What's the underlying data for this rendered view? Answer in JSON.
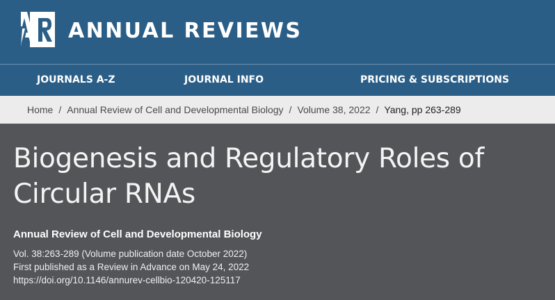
{
  "header": {
    "logo_text": "ANNUAL REVIEWS",
    "colors": {
      "header_bg": "#2a5e87",
      "content_bg": "#545559",
      "breadcrumb_bg": "#ececec"
    }
  },
  "nav": {
    "items": [
      {
        "label": "JOURNALS A-Z"
      },
      {
        "label": "JOURNAL INFO"
      },
      {
        "label": "PRICING & SUBSCRIPTIONS"
      }
    ]
  },
  "breadcrumb": {
    "separator": "/",
    "items": [
      {
        "label": "Home"
      },
      {
        "label": "Annual Review of Cell and Developmental Biology"
      },
      {
        "label": "Volume 38, 2022"
      },
      {
        "label": "Yang, pp 263-289"
      }
    ]
  },
  "article": {
    "title": "Biogenesis and Regulatory Roles of Circular RNAs",
    "journal": "Annual Review of Cell and Developmental Biology",
    "volume_line": "Vol. 38:263-289 (Volume publication date October 2022)",
    "published_line": "First published as a Review in Advance on May 24, 2022",
    "doi": "https://doi.org/10.1146/annurev-cellbio-120420-125117"
  }
}
